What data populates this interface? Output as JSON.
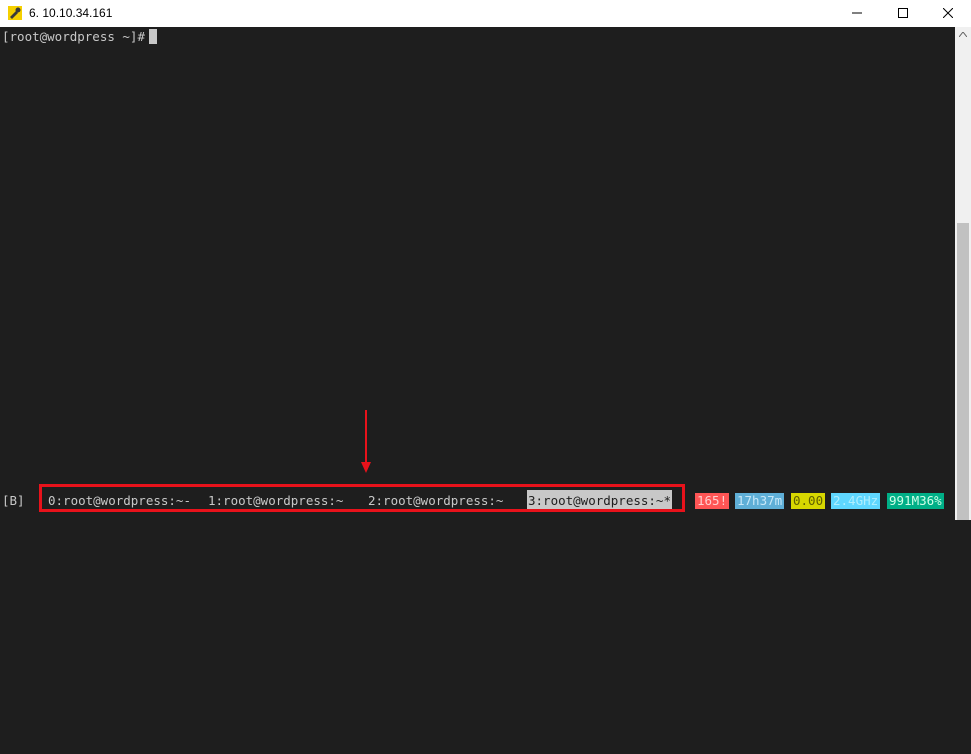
{
  "window": {
    "title": "6. 10.10.34.161",
    "icons": {
      "app": "putty-key-icon",
      "minimize": "minimize-icon",
      "maximize": "maximize-icon",
      "close": "close-icon"
    }
  },
  "terminal": {
    "prompt": "[root@wordpress ~]#"
  },
  "status_bar": {
    "session": "[B]",
    "windows": [
      {
        "label": "0:root@wordpress:~-",
        "active": false
      },
      {
        "label": "1:root@wordpress:~",
        "active": false
      },
      {
        "label": "2:root@wordpress:~",
        "active": false
      },
      {
        "label": "3:root@wordpress:~*",
        "active": true
      }
    ],
    "badges": [
      {
        "name": "alert-count",
        "text": "165!",
        "bg": "#ff5555",
        "fg": "#ffd0d0"
      },
      {
        "name": "uptime",
        "text": "17h37m",
        "bg": "#5fafd7",
        "fg": "#c8e8f8"
      },
      {
        "name": "load-average",
        "text": "0.00",
        "bg": "#d7d700",
        "fg": "#5f5f00"
      },
      {
        "name": "cpu-frequency",
        "text": "2.4GHz",
        "bg": "#5fd7ff",
        "fg": "#afefff"
      },
      {
        "name": "memory-usage",
        "text": "991M36%",
        "bg": "#00af87",
        "fg": "#d0ffe8"
      }
    ]
  },
  "annotation": {
    "highlight_color": "#e8121b"
  }
}
